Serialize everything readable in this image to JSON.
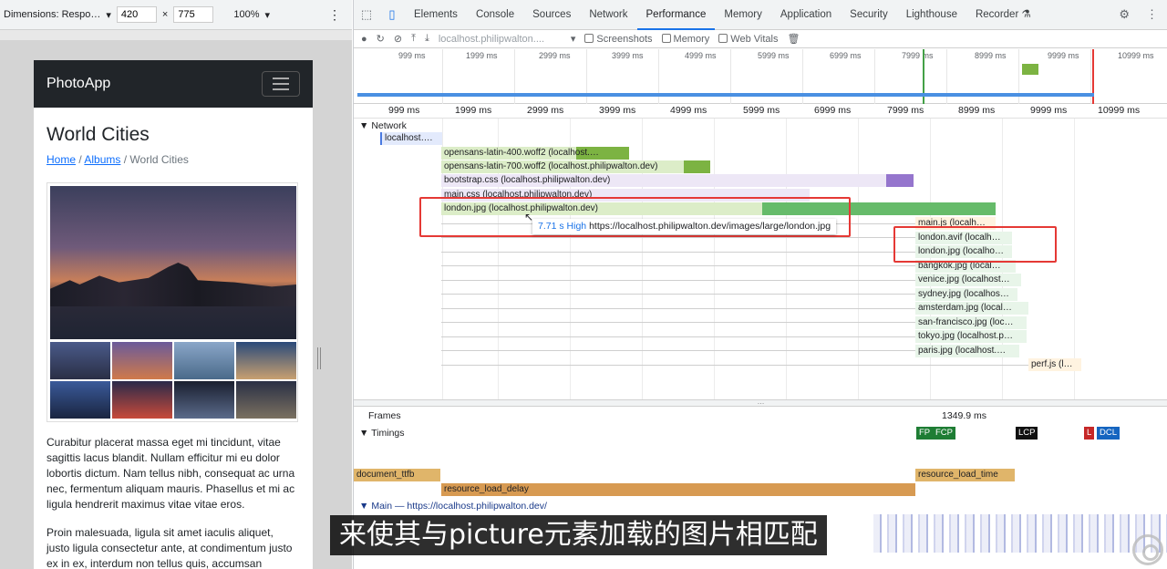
{
  "device_toolbar": {
    "dimensions_label": "Dimensions: Respo…",
    "width": "420",
    "height": "775",
    "times": "×",
    "zoom": "100%"
  },
  "page": {
    "brand": "PhotoApp",
    "title": "World Cities",
    "breadcrumb": {
      "home": "Home",
      "sep1": "/",
      "albums": "Albums",
      "sep2": "/",
      "current": "World Cities"
    },
    "paragraph1": "Curabitur placerat massa eget mi tincidunt, vitae sagittis lacus blandit. Nullam efficitur mi eu dolor lobortis dictum. Nam tellus nibh, consequat ac urna nec, fermentum aliquam mauris. Phasellus et mi ac ligula hendrerit maximus vitae vitae eros.",
    "paragraph2": "Proin malesuada, ligula sit amet iaculis aliquet, justo ligula consectetur ante, at condimentum justo ex in ex, interdum non tellus quis, accumsan"
  },
  "devtools": {
    "tabs": [
      "Elements",
      "Console",
      "Sources",
      "Network",
      "Performance",
      "Memory",
      "Application",
      "Security",
      "Lighthouse",
      "Recorder"
    ],
    "active_tab": "Performance",
    "recorder_icon": "flask-icon",
    "toolbar": {
      "url": "localhost.philipwalton....",
      "screenshots": "Screenshots",
      "memory": "Memory",
      "web_vitals": "Web Vitals"
    },
    "overview_ticks": [
      "999 ms",
      "1999 ms",
      "2999 ms",
      "3999 ms",
      "4999 ms",
      "5999 ms",
      "6999 ms",
      "7999 ms",
      "8999 ms",
      "9999 ms",
      "10999 ms"
    ],
    "ruler_ticks": [
      "999 ms",
      "1999 ms",
      "2999 ms",
      "3999 ms",
      "4999 ms",
      "5999 ms",
      "6999 ms",
      "7999 ms",
      "8999 ms",
      "9999 ms",
      "10999 ms"
    ],
    "network_label": "Network",
    "requests": [
      "localhost….",
      "opensans-latin-400.woff2 (localhost.…",
      "opensans-latin-700.woff2 (localhost.philipwalton.dev)",
      "bootstrap.css (localhost.philipwalton.dev)",
      "main.css (localhost.philipwalton.dev)",
      "london.jpg (localhost.philipwalton.dev)",
      "main.js (localh…",
      "london.avif (localh…",
      "london.jpg (localho…",
      "bangkok.jpg (local…",
      "venice.jpg (localhost…",
      "sydney.jpg (localhos…",
      "amsterdam.jpg (local…",
      "san-francisco.jpg (loc…",
      "tokyo.jpg (localhost.p…",
      "paris.jpg (localhost.…",
      "perf.js (l…"
    ],
    "tooltip": {
      "time": "7.71 s",
      "priority": "High",
      "url": "https://localhost.philipwalton.dev/images/large/london.jpg"
    },
    "frames_label": "Frames",
    "frames_time": "1349.9 ms",
    "timings_label": "Timings",
    "markers": {
      "fp": "FP",
      "fcp": "FCP",
      "lcp": "LCP",
      "l": "L",
      "dcl": "DCL"
    },
    "timings": {
      "ttfb": "document_ttfb",
      "delay": "resource_load_delay",
      "load": "resource_load_time"
    },
    "main_label": "Main — https://localhost.philipwalton.dev/"
  },
  "subtitle": "来使其与picture元素加载的图片相匹配",
  "colors": {
    "accent": "#1a73e8",
    "highlight": "#e53935",
    "font_bar": "#7cb342",
    "css_bar": "#b39ddb",
    "img_bar": "#a5d6a7",
    "timing_bar": "#d7a45a"
  }
}
